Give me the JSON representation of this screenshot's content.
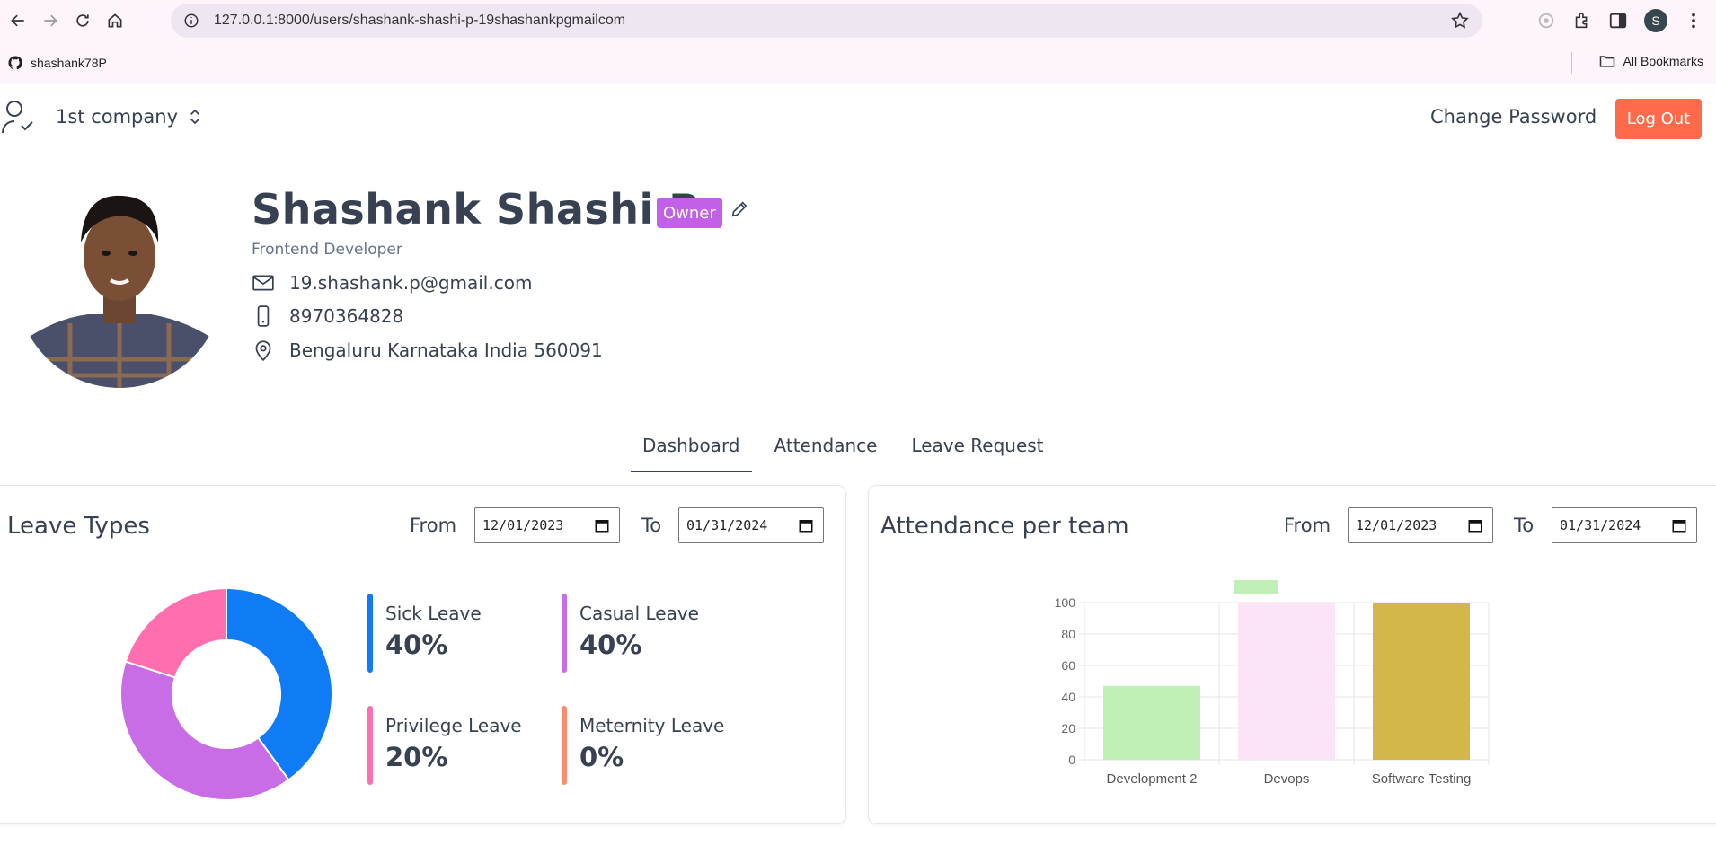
{
  "browser": {
    "url": "127.0.0.1:8000/users/shashank-shashi-p-19shashankpgmailcom",
    "profile_initial": "S",
    "bookmark": "shashank78P",
    "all_bookmarks": "All Bookmarks"
  },
  "header": {
    "company": "1st company",
    "change_password": "Change Password",
    "logout": "Log Out"
  },
  "profile": {
    "name": "Shashank Shashi P",
    "badge": "Owner",
    "title": "Frontend Developer",
    "email": "19.shashank.p@gmail.com",
    "phone": "8970364828",
    "location": "Bengaluru Karnataka India 560091"
  },
  "tabs": [
    {
      "label": "Dashboard",
      "active": true
    },
    {
      "label": "Attendance",
      "active": false
    },
    {
      "label": "Leave Request",
      "active": false
    }
  ],
  "leave_card": {
    "title": "Leave Types",
    "from_label": "From",
    "to_label": "To",
    "from_date": "12/01/2023",
    "to_date": "01/31/2024",
    "legend": [
      {
        "name": "Sick Leave",
        "pct": "40%",
        "color": "#0f7bf5"
      },
      {
        "name": "Casual Leave",
        "pct": "40%",
        "color": "#c86de6"
      },
      {
        "name": "Privilege Leave",
        "pct": "20%",
        "color": "#ff6fb0"
      },
      {
        "name": "Meternity Leave",
        "pct": "0%",
        "color": "#ff8a6d"
      }
    ]
  },
  "attendance_card": {
    "title": "Attendance per team",
    "from_label": "From",
    "to_label": "To",
    "from_date": "12/01/2023",
    "to_date": "01/31/2024"
  },
  "chart_data": [
    {
      "type": "pie",
      "categories": [
        "Sick Leave",
        "Casual Leave",
        "Privilege Leave",
        "Meternity Leave"
      ],
      "values": [
        40,
        40,
        20,
        0
      ],
      "colors": [
        "#0f7bf5",
        "#c86de6",
        "#ff6fb0",
        "#ff8a6d"
      ]
    },
    {
      "type": "bar",
      "categories": [
        "Development 2",
        "Devops",
        "Software Testing"
      ],
      "values": [
        47,
        100,
        100
      ],
      "colors": [
        "#c0efb8",
        "#fce4f7",
        "#d4b64a"
      ],
      "ylim": [
        0,
        100
      ],
      "yticks": [
        0,
        20,
        40,
        60,
        80,
        100
      ],
      "grid": true,
      "legend": "top"
    }
  ]
}
